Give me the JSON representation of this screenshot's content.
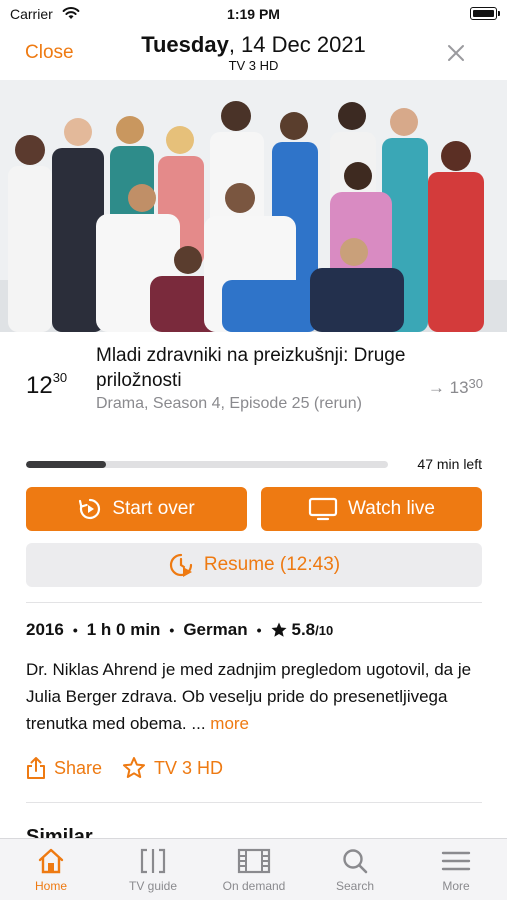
{
  "status_bar": {
    "carrier": "Carrier",
    "time": "1:19 PM"
  },
  "nav": {
    "close_label": "Close",
    "title_day": "Tuesday",
    "title_date": ", 14 Dec 2021",
    "channel": "TV 3 HD"
  },
  "program": {
    "start_hour": "12",
    "start_min": "30",
    "end_arrow": "→",
    "end_hour": "13",
    "end_min": "30",
    "title": "Mladi zdravniki na preizkušnji: Druge priložnosti",
    "meta": "Drama, Season 4, Episode 25 (rerun)",
    "progress_percent": 22,
    "time_left": "47 min left"
  },
  "buttons": {
    "start_over": "Start over",
    "watch_live": "Watch live",
    "resume": "Resume (12:43)"
  },
  "details": {
    "year": "2016",
    "duration": "1 h 0 min",
    "language": "German",
    "rating": "5.8",
    "rating_max": "/10",
    "separator": "•"
  },
  "description": {
    "text": "Dr. Niklas Ahrend je med zadnjim pregledom ugotovil, da je Julia Berger zdrava. Ob veselju pride do presenetljivega trenutka med obema. ...",
    "more": "more"
  },
  "actions": {
    "share": "Share",
    "channel": "TV 3 HD"
  },
  "sections": {
    "similar": "Similar"
  },
  "tabbar": {
    "items": [
      {
        "label": "Home",
        "icon": "home-icon",
        "active": true
      },
      {
        "label": "TV guide",
        "icon": "tv-guide-icon",
        "active": false
      },
      {
        "label": "On demand",
        "icon": "film-icon",
        "active": false
      },
      {
        "label": "Search",
        "icon": "search-icon",
        "active": false
      },
      {
        "label": "More",
        "icon": "menu-icon",
        "active": false
      }
    ]
  },
  "colors": {
    "accent": "#ee7a12",
    "muted": "#8a8a8e",
    "progress": "#3a3a3c"
  }
}
